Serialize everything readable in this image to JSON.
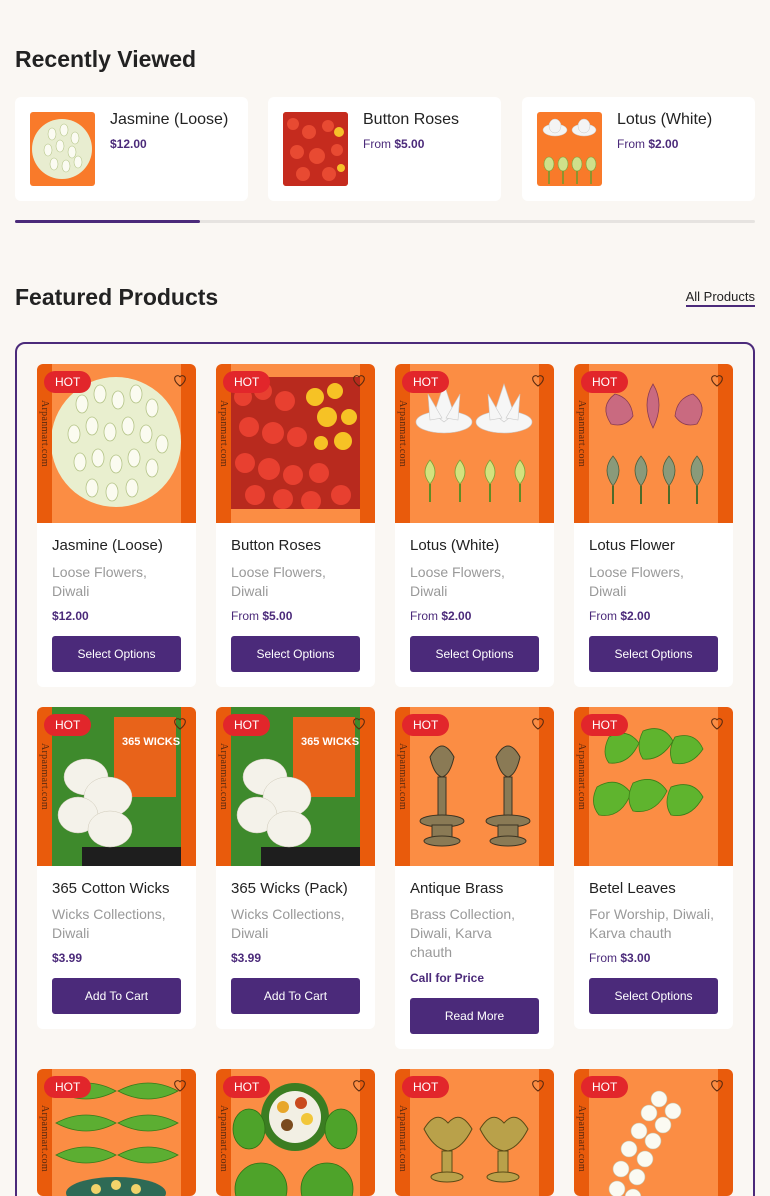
{
  "recently_viewed": {
    "title": "Recently Viewed",
    "items": [
      {
        "name": "Jasmine (Loose)",
        "from": "",
        "price": "$12.00"
      },
      {
        "name": "Button Roses",
        "from": "From",
        "price": "$5.00"
      },
      {
        "name": "Lotus (White)",
        "from": "From",
        "price": "$2.00"
      }
    ],
    "scroll_fraction": 0.25
  },
  "featured": {
    "title": "Featured Products",
    "all_link": "All Products",
    "badge": "HOT",
    "watermark": "Arpanmart.com",
    "products": [
      {
        "name": "Jasmine (Loose)",
        "cats": "Loose Flowers, Diwali",
        "from": "",
        "price": "$12.00",
        "button": "Select Options"
      },
      {
        "name": "Button Roses",
        "cats": "Loose Flowers, Diwali",
        "from": "From",
        "price": "$5.00",
        "button": "Select Options"
      },
      {
        "name": "Lotus (White)",
        "cats": "Loose Flowers, Diwali",
        "from": "From",
        "price": "$2.00",
        "button": "Select Options"
      },
      {
        "name": "Lotus Flower",
        "cats": "Loose Flowers, Diwali",
        "from": "From",
        "price": "$2.00",
        "button": "Select Options"
      },
      {
        "name": "365 Cotton Wicks",
        "cats": "Wicks Collections, Diwali",
        "from": "",
        "price": "$3.99",
        "button": "Add To Cart"
      },
      {
        "name": "365 Wicks (Pack)",
        "cats": "Wicks Collections, Diwali",
        "from": "",
        "price": "$3.99",
        "button": "Add To Cart"
      },
      {
        "name": "Antique Brass",
        "cats": "Brass Collection, Diwali, Karva chauth",
        "from": "",
        "price": "Call for Price",
        "button": "Read More"
      },
      {
        "name": "Betel Leaves",
        "cats": "For Worship, Diwali, Karva chauth",
        "from": "From",
        "price": "$3.00",
        "button": "Select Options"
      }
    ]
  },
  "colors": {
    "accent": "#4b2a7a",
    "hot": "#e2262b",
    "image_bg": "#fb8d44"
  },
  "icons": [
    "heart-icon"
  ]
}
